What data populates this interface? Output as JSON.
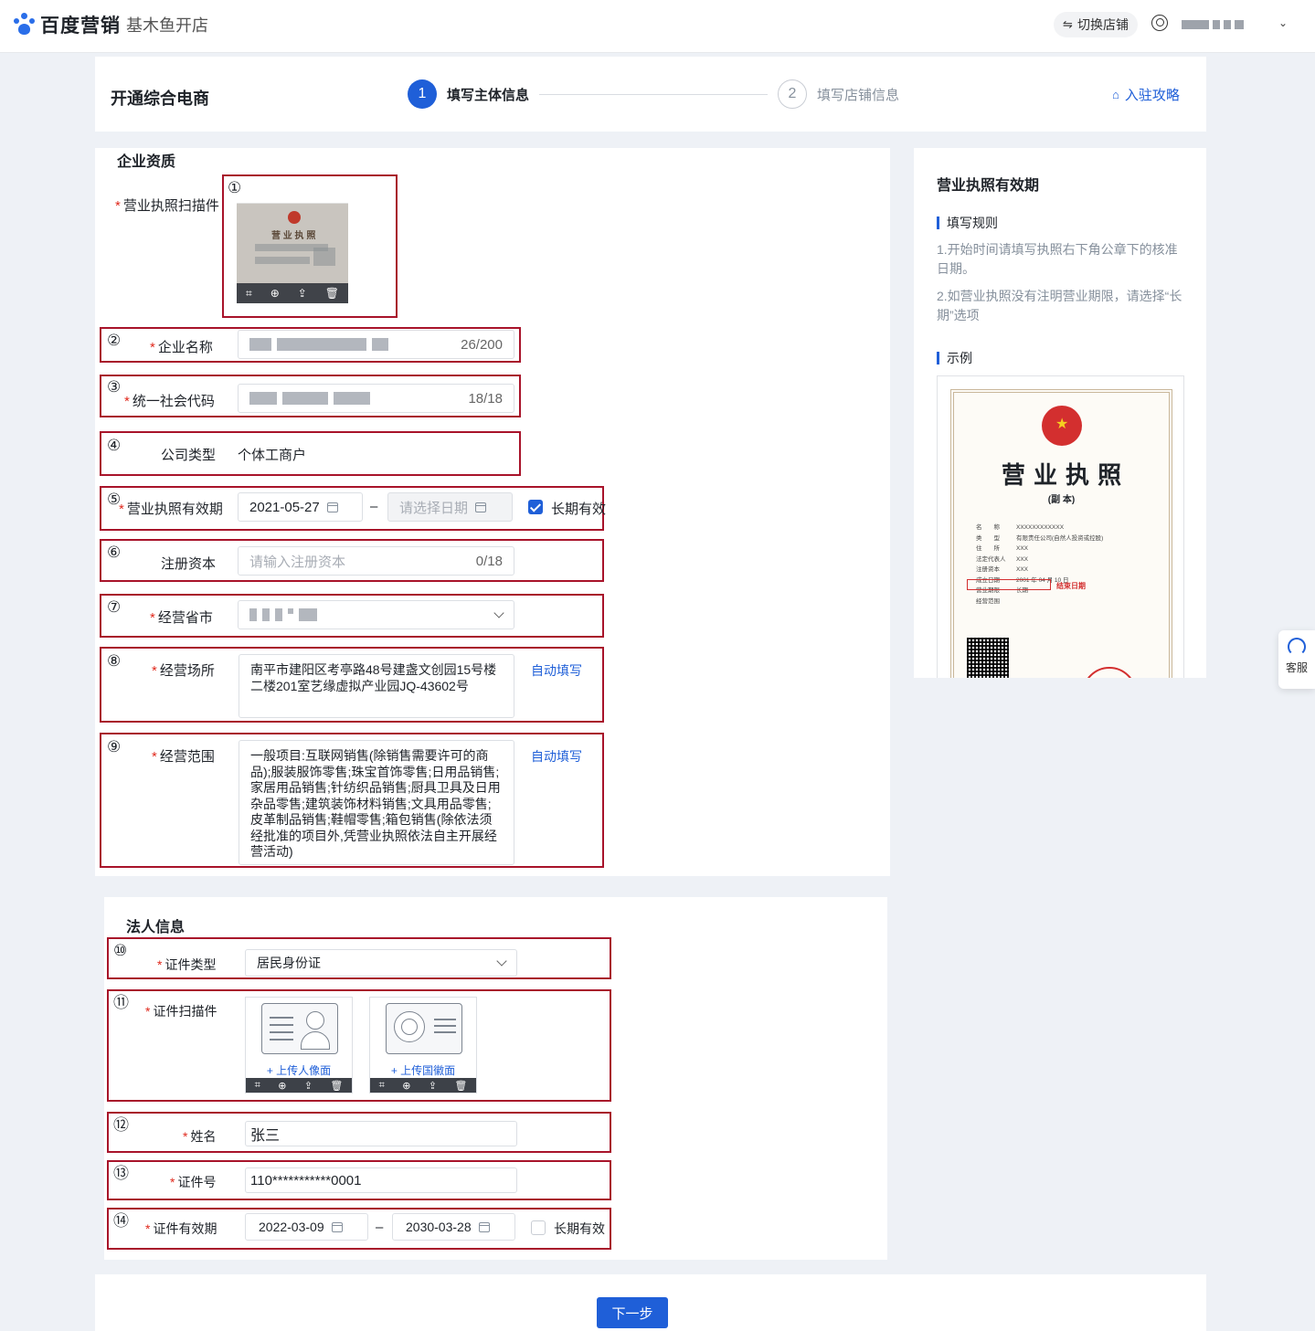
{
  "topbar": {
    "brand": "百度营销",
    "sub_brand": "基木鱼开店",
    "switch_shop": "切换店铺"
  },
  "header": {
    "title": "开通综合电商",
    "steps": [
      {
        "index": "1",
        "label": "填写主体信息"
      },
      {
        "index": "2",
        "label": "填写店铺信息"
      }
    ],
    "guide_link": "入驻攻略"
  },
  "company": {
    "section_title": "企业资质",
    "license_scan": {
      "num": "①",
      "label": "营业执照扫描件",
      "thumb_text": "营 业 执 照"
    },
    "company_name": {
      "num": "②",
      "label": "企业名称",
      "count": "26/200"
    },
    "credit_code": {
      "num": "③",
      "label": "统一社会代码",
      "count": "18/18"
    },
    "company_type": {
      "num": "④",
      "label": "公司类型",
      "value": "个体工商户"
    },
    "validity": {
      "num": "⑤",
      "label": "营业执照有效期",
      "start": "2021-05-27",
      "separator": "–",
      "end_placeholder": "请选择日期",
      "long_term": "长期有效",
      "long_term_checked": true
    },
    "capital": {
      "num": "⑥",
      "label": "注册资本",
      "placeholder": "请输入注册资本",
      "count": "0/18"
    },
    "province": {
      "num": "⑦",
      "label": "经营省市"
    },
    "address": {
      "num": "⑧",
      "label": "经营场所",
      "value": "南平市建阳区考亭路48号建盏文创园15号楼二楼201室艺缘虚拟产业园JQ-43602号",
      "auto_fill": "自动填写"
    },
    "scope": {
      "num": "⑨",
      "label": "经营范围",
      "value": "一般项目:互联网销售(除销售需要许可的商品);服装服饰零售;珠宝首饰零售;日用品销售;家居用品销售;针纺织品销售;厨具卫具及日用杂品零售;建筑装饰材料销售;文具用品零售;皮革制品销售;鞋帽零售;箱包销售(除依法须经批准的项目外,凭营业执照依法自主开展经营活动)",
      "auto_fill": "自动填写"
    }
  },
  "legal": {
    "section_title": "法人信息",
    "id_type": {
      "num": "⑩",
      "label": "证件类型",
      "value": "居民身份证"
    },
    "id_scan": {
      "num": "⑪",
      "label": "证件扫描件",
      "front": "+ 上传人像面",
      "back": "+ 上传国徽面"
    },
    "name": {
      "num": "⑫",
      "label": "姓名",
      "value": "张三"
    },
    "id_number": {
      "num": "⑬",
      "label": "证件号",
      "value": "110***********0001"
    },
    "id_validity": {
      "num": "⑭",
      "label": "证件有效期",
      "start": "2022-03-09",
      "separator": "–",
      "end": "2030-03-28",
      "long_term": "长期有效",
      "long_term_checked": false
    }
  },
  "guide": {
    "title": "营业执照有效期",
    "rules_title": "填写规则",
    "rule1": "1.开始时间请填写执照右下角公章下的核准日期。",
    "rule2": "2.如营业执照没有注明营业期限，请选择“长期”选项",
    "example_title": "示例",
    "sample": {
      "heading": "营 业 执 照",
      "copy": "(副 本)",
      "rows": [
        {
          "k": "名　　称",
          "v": "XXXXXXXXXXXX"
        },
        {
          "k": "类　　型",
          "v": "有限责任公司(自然人投资或控股)"
        },
        {
          "k": "住　　所",
          "v": "XXX"
        },
        {
          "k": "法定代表人",
          "v": "XXX"
        },
        {
          "k": "注册资本",
          "v": "XXX"
        },
        {
          "k": "成立日期",
          "v": "2001 年 04 月 10 日"
        },
        {
          "k": "营业期限",
          "v": "长期"
        },
        {
          "k": "经营范围",
          "v": ""
        }
      ],
      "end_date_note": "结束日期"
    }
  },
  "service": {
    "label": "客服"
  },
  "footer": {
    "next": "下一步"
  },
  "colors": {
    "primary": "#1f5fd8",
    "annotation": "#a8132a",
    "required": "#e0291d"
  }
}
